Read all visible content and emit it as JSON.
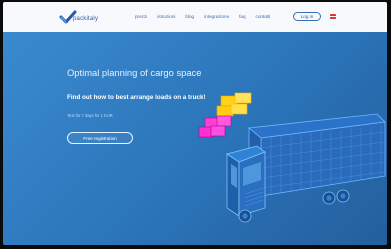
{
  "header": {
    "logo_text": "packitaly",
    "nav": [
      {
        "label": "prezzi"
      },
      {
        "label": "istruzioni"
      },
      {
        "label": "blog"
      },
      {
        "label": "integrazione"
      },
      {
        "label": "faq"
      },
      {
        "label": "contatti"
      }
    ],
    "login_label": "Log in"
  },
  "hero": {
    "title": "Optimal planning of cargo space",
    "subtitle": "Find out how to best arrange loads on a truck!",
    "small_text": "Test for 7 days for 1 EUR",
    "cta_label": "Free registration"
  },
  "colors": {
    "hero_blue": "#2f7cc0",
    "header_bg": "#f7f9fc",
    "accent_blue": "#2d5aa6"
  },
  "icons": {
    "logo": "checkmark-logo",
    "language": "flag-icon"
  }
}
